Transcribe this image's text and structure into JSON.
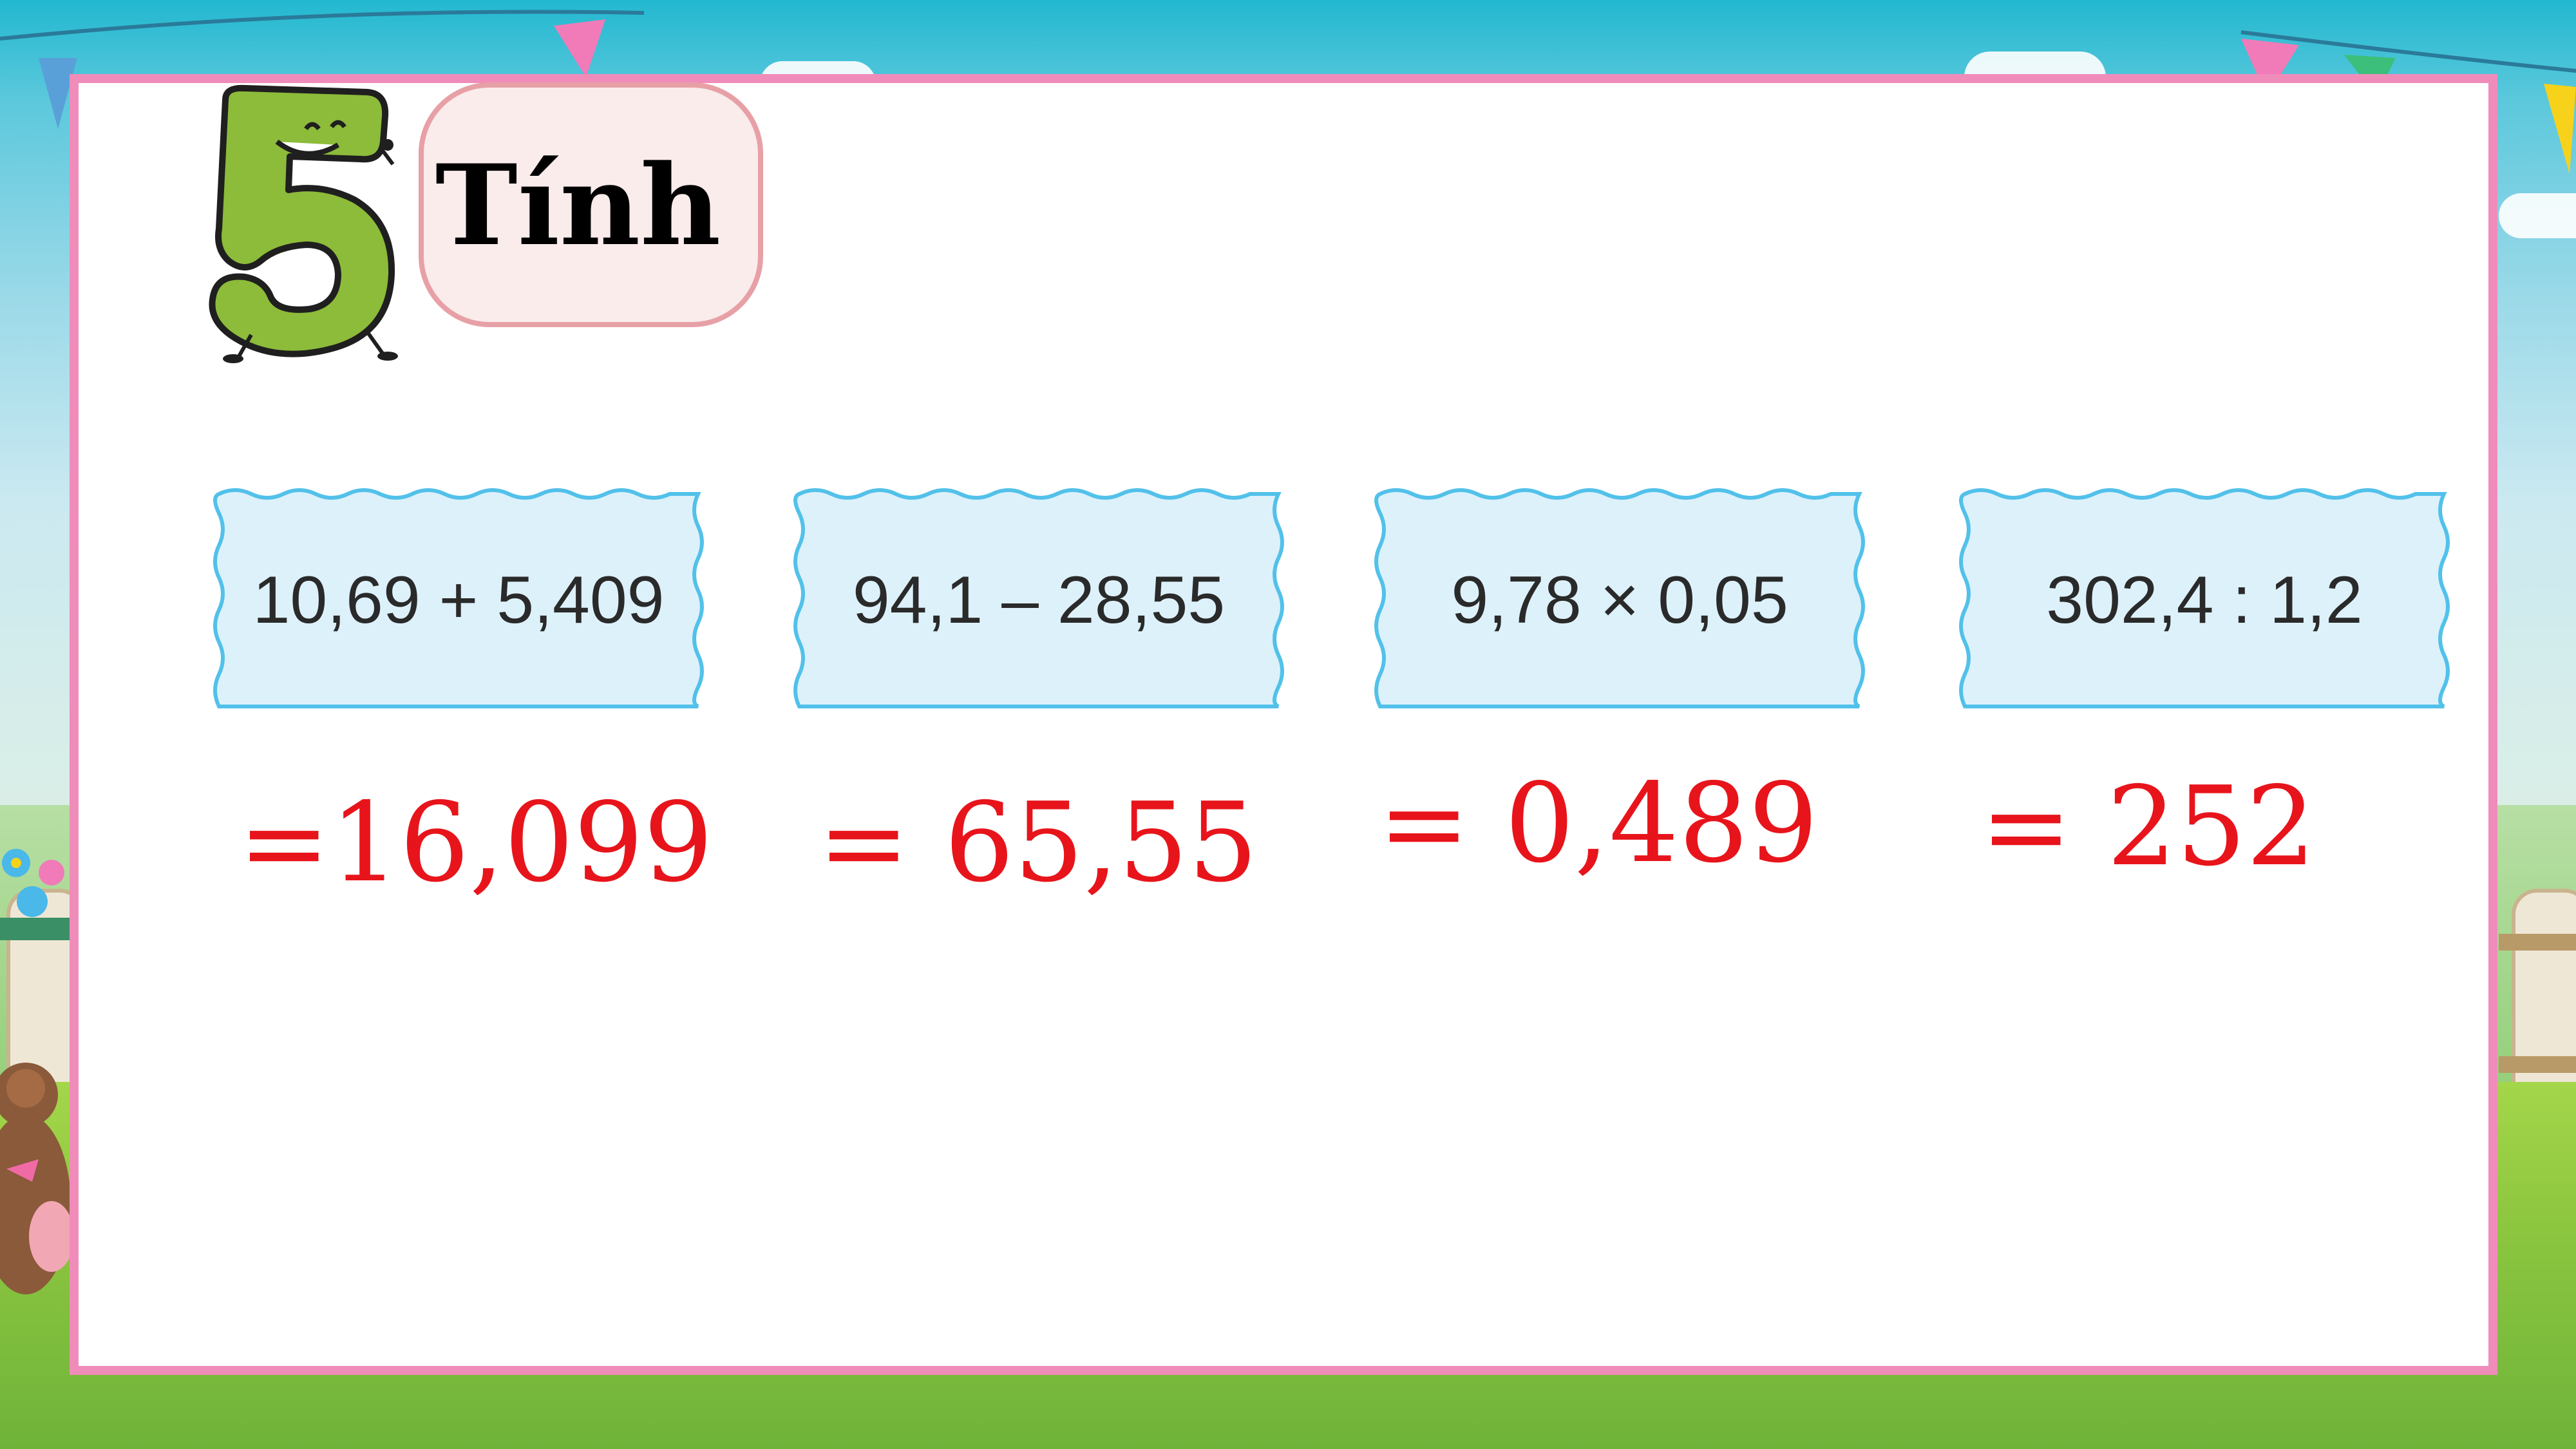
{
  "exercise": {
    "number": "5",
    "title": "Tính"
  },
  "problems": [
    {
      "expression": "10,69 + 5,409",
      "answer": "=16,099"
    },
    {
      "expression": "94,1 – 28,55",
      "answer": "= 65,55"
    },
    {
      "expression": "9,78 × 0,05",
      "answer": "= 0,489"
    },
    {
      "expression": "302,4 : 1,2",
      "answer": "= 252"
    }
  ],
  "colors": {
    "card_border": "#f08cba",
    "expression_box_fill": "#ddf1fb",
    "expression_box_border": "#52c1ea",
    "answer_text": "#e8141b",
    "number_mascot": "#8dbb3a"
  },
  "icons": {
    "mascot": "number-five-mascot-icon"
  }
}
